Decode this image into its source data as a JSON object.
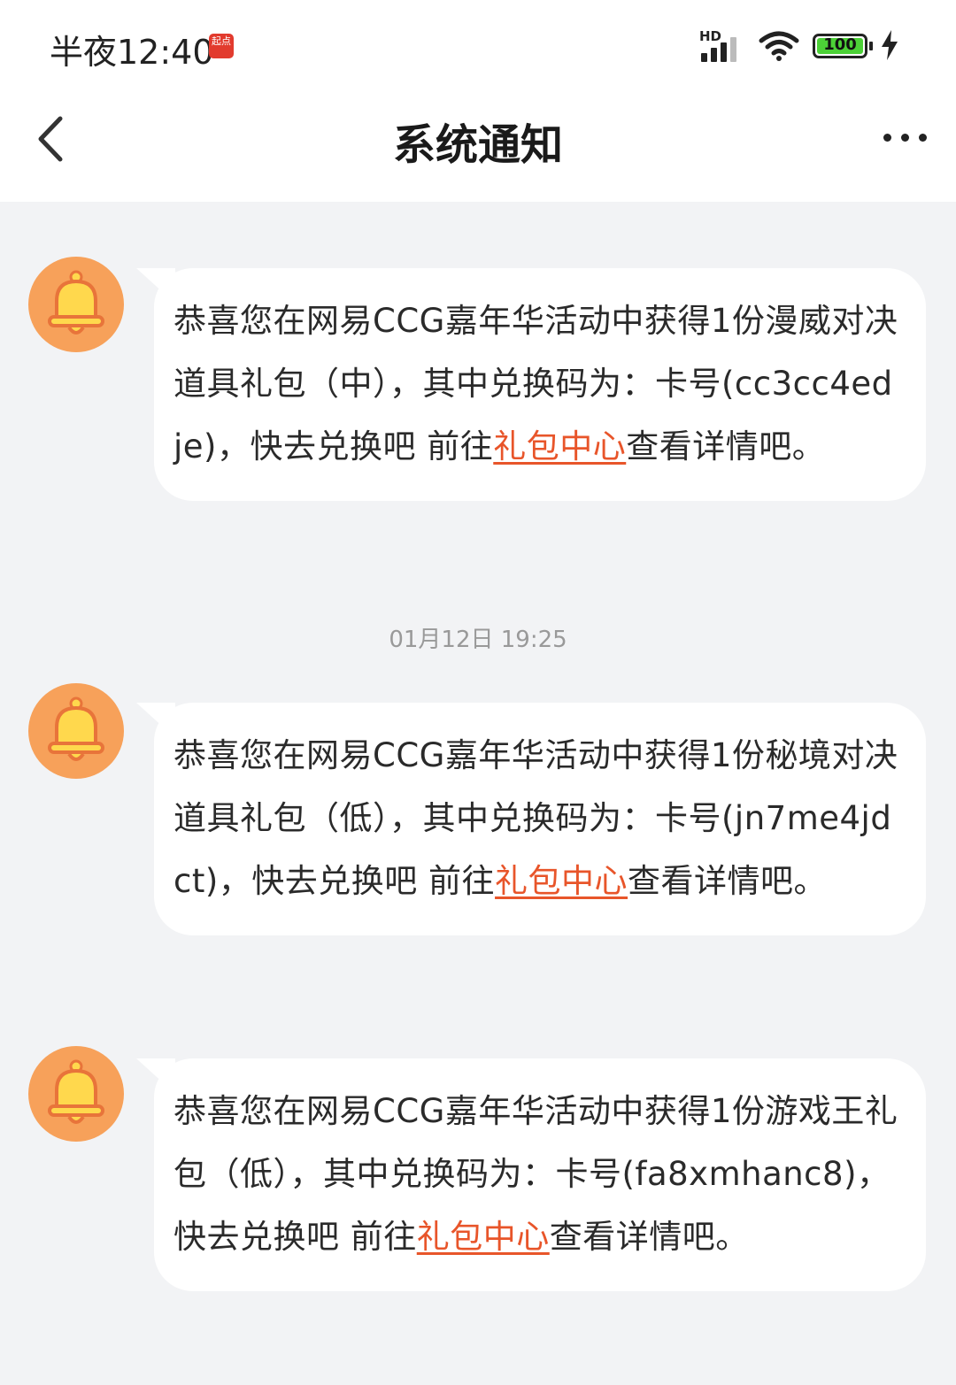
{
  "status_bar": {
    "time": "半夜12:40",
    "app_badge": "起点",
    "network": "HD",
    "battery": "100"
  },
  "nav": {
    "title": "系统通知"
  },
  "timestamp": "01月12日 19:25",
  "messages": [
    {
      "text_before": "恭喜您在网易CCG嘉年华活动中获得1份漫威对决道具礼包（中），其中兑换码为：卡号(cc3cc4edje)，快去兑换吧 前往",
      "link": "礼包中心",
      "text_after": "查看详情吧。"
    },
    {
      "text_before": "恭喜您在网易CCG嘉年华活动中获得1份秘境对决道具礼包（低），其中兑换码为：卡号(jn7me4jdct)，快去兑换吧 前往",
      "link": "礼包中心",
      "text_after": "查看详情吧。"
    },
    {
      "text_before": "恭喜您在网易CCG嘉年华活动中获得1份游戏王礼包（低），其中兑换码为：卡号(fa8xmhanc8)，快去兑换吧 前往",
      "link": "礼包中心",
      "text_after": "查看详情吧。"
    }
  ],
  "colors": {
    "link": "#e8552a",
    "avatar": "#f7a15a",
    "bell": "#ffd84d",
    "background": "#f2f3f5"
  }
}
